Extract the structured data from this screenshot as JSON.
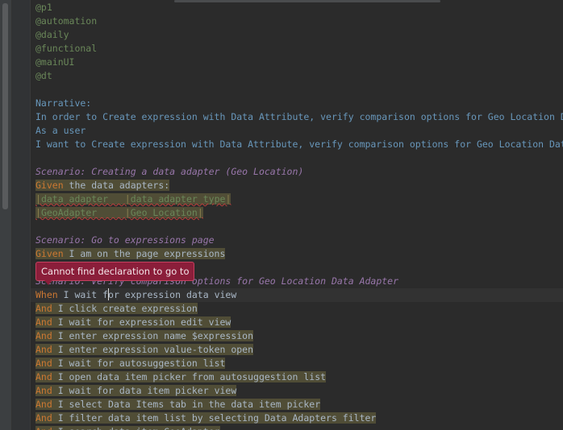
{
  "editor": {
    "lines": [
      {
        "text": "@p1",
        "kind": "tag"
      },
      {
        "text": "@automation",
        "kind": "tag"
      },
      {
        "text": "@daily",
        "kind": "tag"
      },
      {
        "text": "@functional",
        "kind": "tag"
      },
      {
        "text": "@mainUI",
        "kind": "tag"
      },
      {
        "text": "@dt",
        "kind": "tag"
      },
      {
        "text": "",
        "kind": "blank"
      },
      {
        "text": "Narrative:",
        "kind": "narr"
      },
      {
        "text": "In order to Create expression with Data Attribute, verify comparison options for Geo Location Data Adapter",
        "kind": "narr"
      },
      {
        "text": "As a user",
        "kind": "narr"
      },
      {
        "text": "I want to Create expression with Data Attribute, verify comparison options for Geo Location Data Adapter",
        "kind": "narr"
      },
      {
        "text": "",
        "kind": "blank"
      },
      {
        "text": "Scenario: Creating a data adapter (Geo Location)",
        "kind": "scenario"
      },
      {
        "keyword": "Given",
        "text": " the data adapters:",
        "kind": "step",
        "highlight": true
      },
      {
        "cells": [
          "data adapter   ",
          "data adapter type"
        ],
        "kind": "table"
      },
      {
        "cells": [
          "GeoAdapter     ",
          "Geo Location"
        ],
        "kind": "table"
      },
      {
        "text": "",
        "kind": "blank"
      },
      {
        "text": "Scenario: Go to expressions page",
        "kind": "scenario"
      },
      {
        "keyword": "Given",
        "text": " I am on the page expressions",
        "kind": "step",
        "highlight": true
      },
      {
        "text": "",
        "kind": "blank"
      },
      {
        "text": "Scenario: Verify comparison options for Geo Location Data Adapter",
        "kind": "scenario"
      },
      {
        "keyword": "When",
        "text": " I wait for expression data view",
        "kind": "step",
        "highlight": false,
        "caret": true
      },
      {
        "keyword": "And",
        "text": " I click create expression",
        "kind": "step",
        "highlight": true
      },
      {
        "keyword": "And",
        "text": " I wait for expression edit view",
        "kind": "step",
        "highlight": true
      },
      {
        "keyword": "And",
        "text": " I enter expression name $expression",
        "kind": "step",
        "highlight": true
      },
      {
        "keyword": "And",
        "text": " I enter expression value-token open",
        "kind": "step",
        "highlight": true
      },
      {
        "keyword": "And",
        "text": " I wait for autosuggestion list",
        "kind": "step",
        "highlight": true
      },
      {
        "keyword": "And",
        "text": " I open data item picker from autosuggestion list",
        "kind": "step",
        "highlight": true
      },
      {
        "keyword": "And",
        "text": " I wait for data item picker view",
        "kind": "step",
        "highlight": true
      },
      {
        "keyword": "And",
        "text": " I select Data Items tab in the data item picker",
        "kind": "step",
        "highlight": true
      },
      {
        "keyword": "And",
        "text": " I filter data item list by selecting Data Adapters filter",
        "kind": "step",
        "highlight": true
      },
      {
        "keyword": "And",
        "text": " I search data item GeoAdapter",
        "kind": "step",
        "highlight": true
      }
    ]
  },
  "tooltip": {
    "text": "Cannot find declaration to go to"
  },
  "colors": {
    "background": "#2b2b2b",
    "tag": "#6a8759",
    "narrative": "#6897bb",
    "scenario": "#9876aa",
    "keyword": "#cc7832",
    "step_highlight": "#504d36",
    "tooltip": "#8b1e3a"
  }
}
